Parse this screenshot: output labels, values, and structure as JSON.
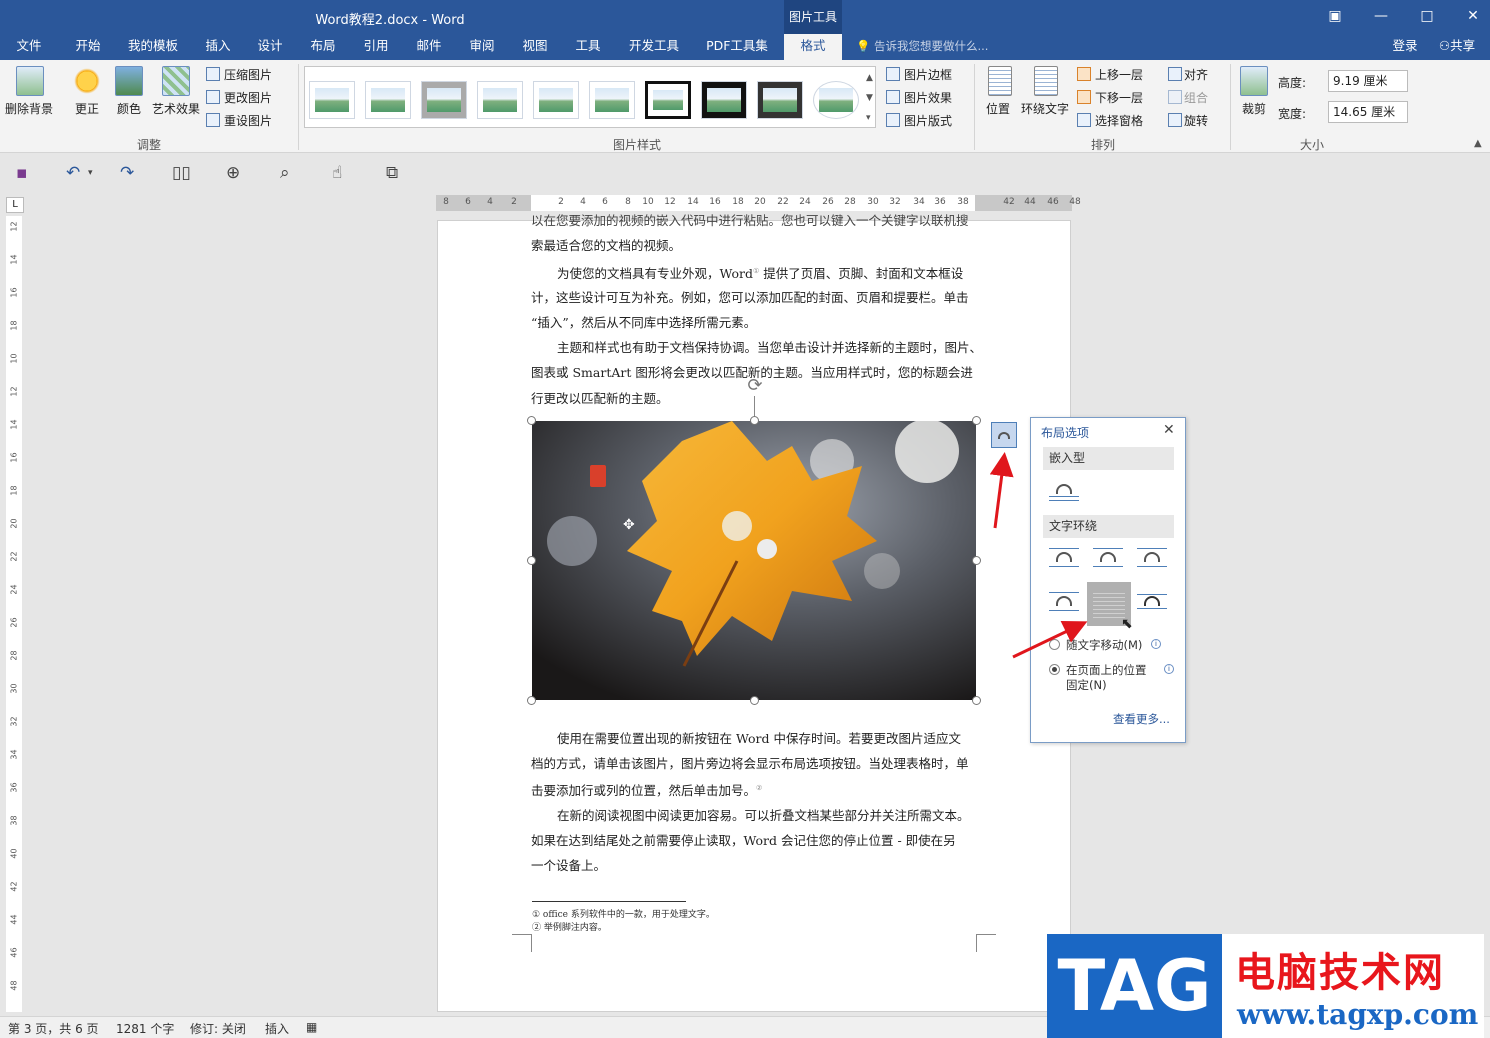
{
  "window": {
    "title": "Word教程2.docx - Word",
    "context_tab_group": "图片工具"
  },
  "tabs": [
    "文件",
    "开始",
    "我的模板",
    "插入",
    "设计",
    "布局",
    "引用",
    "邮件",
    "审阅",
    "视图",
    "工具",
    "开发工具",
    "PDF工具集",
    "格式"
  ],
  "active_tab": "格式",
  "tell_me": "告诉我您想要做什么...",
  "account": {
    "login": "登录",
    "share": "共享"
  },
  "ribbon": {
    "remove_bg": "删除背景",
    "adjust": {
      "corrections": "更正",
      "color": "颜色",
      "artistic": "艺术效果",
      "compress": "压缩图片",
      "change": "更改图片",
      "reset": "重设图片",
      "group_label": "调整"
    },
    "styles": {
      "border": "图片边框",
      "effects": "图片效果",
      "layout": "图片版式",
      "group_label": "图片样式"
    },
    "arrange": {
      "position": "位置",
      "wrap": "环绕文字",
      "bring_forward": "上移一层",
      "send_backward": "下移一层",
      "selection_pane": "选择窗格",
      "align": "对齐",
      "group": "组合",
      "rotate": "旋转",
      "group_label": "排列"
    },
    "size": {
      "crop": "裁剪",
      "height_label": "高度:",
      "height_value": "9.19 厘米",
      "width_label": "宽度:",
      "width_value": "14.65 厘米",
      "group_label": "大小"
    }
  },
  "hruler_ticks": [
    "8",
    "6",
    "4",
    "2",
    "2",
    "4",
    "6",
    "8",
    "10",
    "12",
    "14",
    "16",
    "18",
    "20",
    "22",
    "24",
    "26",
    "28",
    "30",
    "32",
    "34",
    "36",
    "38",
    "42",
    "44",
    "46",
    "48"
  ],
  "vruler_ticks": [
    "12",
    "14",
    "16",
    "18",
    "10",
    "12",
    "14",
    "16",
    "18",
    "20",
    "22",
    "24",
    "26",
    "28",
    "30",
    "32",
    "34",
    "36",
    "38",
    "40",
    "42",
    "44",
    "46",
    "48"
  ],
  "document": {
    "p0a": "以在您要添加的视频的嵌入代码中进行粘贴。您也可以键入一个关键字以联机搜",
    "p0b": "索最适合您的文档的视频。",
    "p1a": "为使您的文档具有专业外观，Word",
    "p1a_sup": "①",
    "p1a_rest": " 提供了页眉、页脚、封面和文本框设",
    "p1b": "计，这些设计可互为补充。例如，您可以添加匹配的封面、页眉和提要栏。单击",
    "p1c": "“插入”，然后从不同库中选择所需元素。",
    "p2a": "主题和样式也有助于文档保持协调。当您单击设计并选择新的主题时，图片、",
    "p2b": "图表或 SmartArt 图形将会更改以匹配新的主题。当应用样式时，您的标题会进",
    "p2c": "行更改以匹配新的主题。",
    "p3a": "使用在需要位置出现的新按钮在 Word 中保存时间。若要更改图片适应文",
    "p3b": "档的方式，请单击该图片，图片旁边将会显示布局选项按钮。当处理表格时，单",
    "p3c": "击要添加行或列的位置，然后单击加号。",
    "p3c_sup": "②",
    "p4a": "在新的阅读视图中阅读更加容易。可以折叠文档某些部分并关注所需文本。",
    "p4b": "如果在达到结尾处之前需要停止读取，Word 会记住您的停止位置 - 即使在另",
    "p4c": "一个设备上。",
    "fn1": "① office 系列软件中的一款，用于处理文字。",
    "fn2": "② 举例脚注内容。"
  },
  "layout_panel": {
    "title": "布局选项",
    "inline_section": "嵌入型",
    "wrap_section": "文字环绕",
    "move_with_text": "随文字移动(M)",
    "fix_position": "在页面上的位置",
    "fix_position2": "固定(N)",
    "see_more": "查看更多..."
  },
  "status": {
    "page": "第 3 页，共 6 页",
    "words": "1281 个字",
    "track": "修订: 关闭",
    "mode": "插入"
  },
  "watermark": {
    "tag": "TAG",
    "site_name": "电脑技术网",
    "url": "www.tagxp.com"
  },
  "colors": {
    "accent": "#2b579a",
    "annotation_arrow": "#e0161c"
  }
}
